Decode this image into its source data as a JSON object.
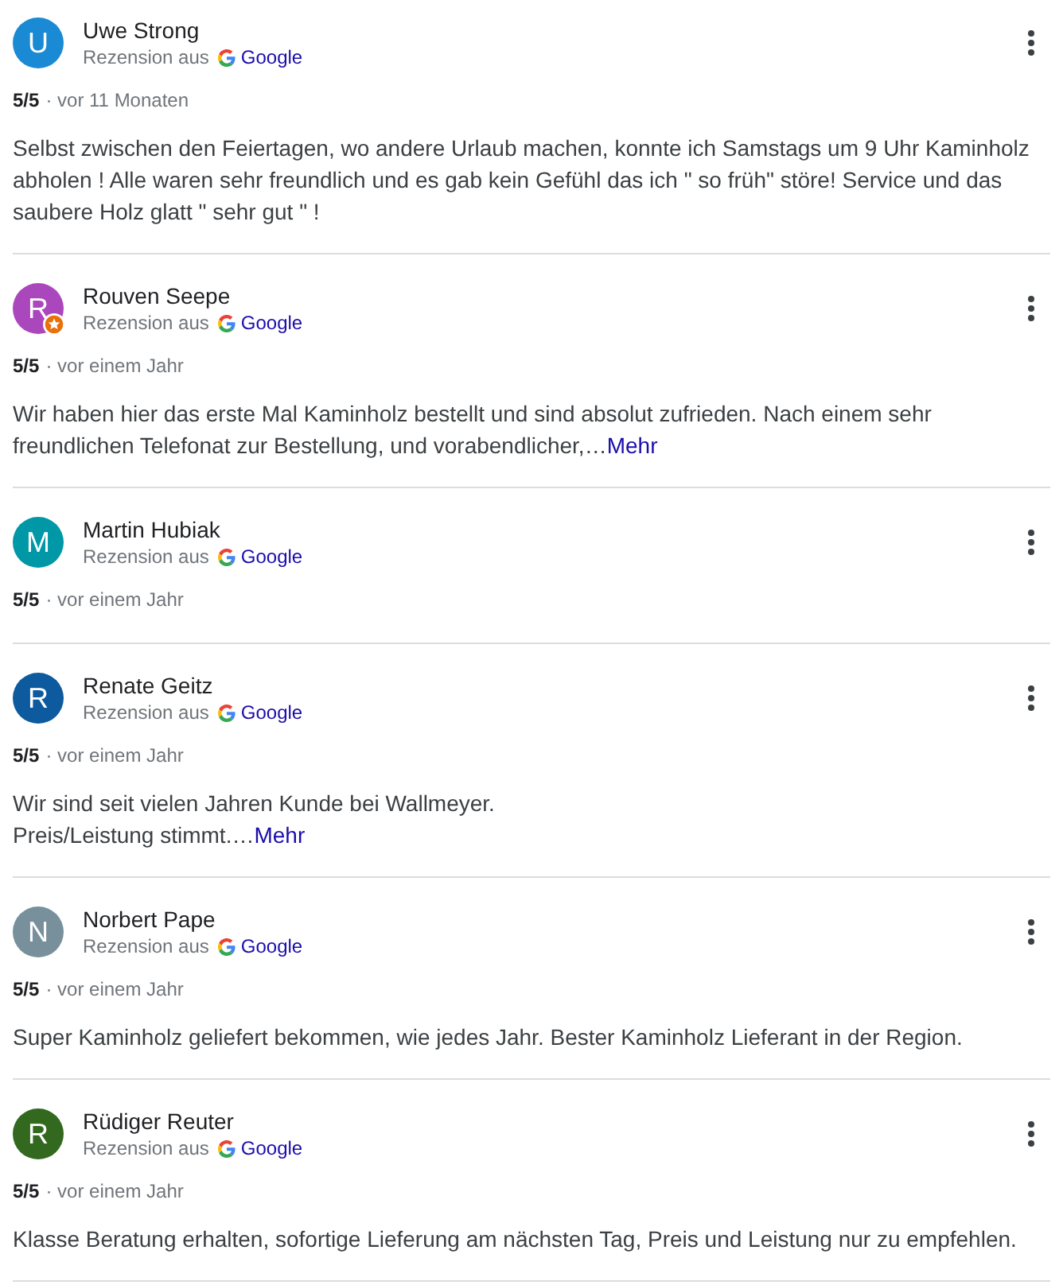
{
  "reviews": [
    {
      "author": "Uwe Strong",
      "initial": "U",
      "color": "#1a8ad4",
      "local_guide": false,
      "source_label": "Rezension aus",
      "source": "Google",
      "rating": "5/5",
      "time": "· vor 11 Monaten",
      "text": "Selbst zwischen den Feiertagen, wo andere Urlaub machen, konnte ich Samstags um 9 Uhr Kaminholz abholen ! Alle waren sehr freundlich und es gab kein Gefühl das ich \" so früh\" störe! Service und das saubere Holz glatt \" sehr gut \" !"
    },
    {
      "author": "Rouven Seepe",
      "initial": "R",
      "color": "#ab47bc",
      "local_guide": true,
      "source_label": "Rezension aus",
      "source": "Google",
      "rating": "5/5",
      "time": "· vor einem Jahr",
      "text": "Wir haben hier das erste Mal Kaminholz bestellt und sind absolut zufrieden. Nach einem sehr freundlichen Telefonat zur Bestellung, und vorabendlicher,…",
      "more": "Mehr"
    },
    {
      "author": "Martin Hubiak",
      "initial": "M",
      "color": "#0097a7",
      "local_guide": false,
      "source_label": "Rezension aus",
      "source": "Google",
      "rating": "5/5",
      "time": "· vor einem Jahr"
    },
    {
      "author": "Renate Geitz",
      "initial": "R",
      "color": "#0d5a9e",
      "local_guide": false,
      "source_label": "Rezension aus",
      "source": "Google",
      "rating": "5/5",
      "time": "· vor einem Jahr",
      "text": "Wir sind seit vielen Jahren Kunde bei Wallmeyer.\nPreis/Leistung stimmt.…",
      "more": "Mehr"
    },
    {
      "author": "Norbert Pape",
      "initial": "N",
      "color": "#78909c",
      "local_guide": false,
      "source_label": "Rezension aus",
      "source": "Google",
      "rating": "5/5",
      "time": "· vor einem Jahr",
      "text": "Super Kaminholz geliefert bekommen, wie jedes Jahr. Bester Kaminholz Lieferant in der Region."
    },
    {
      "author": "Rüdiger Reuter",
      "initial": "R",
      "color": "#33691e",
      "local_guide": false,
      "source_label": "Rezension aus",
      "source": "Google",
      "rating": "5/5",
      "time": "· vor einem Jahr",
      "text": "Klasse Beratung erhalten, sofortige Lieferung am nächsten Tag, Preis und Leistung nur zu empfehlen."
    }
  ]
}
